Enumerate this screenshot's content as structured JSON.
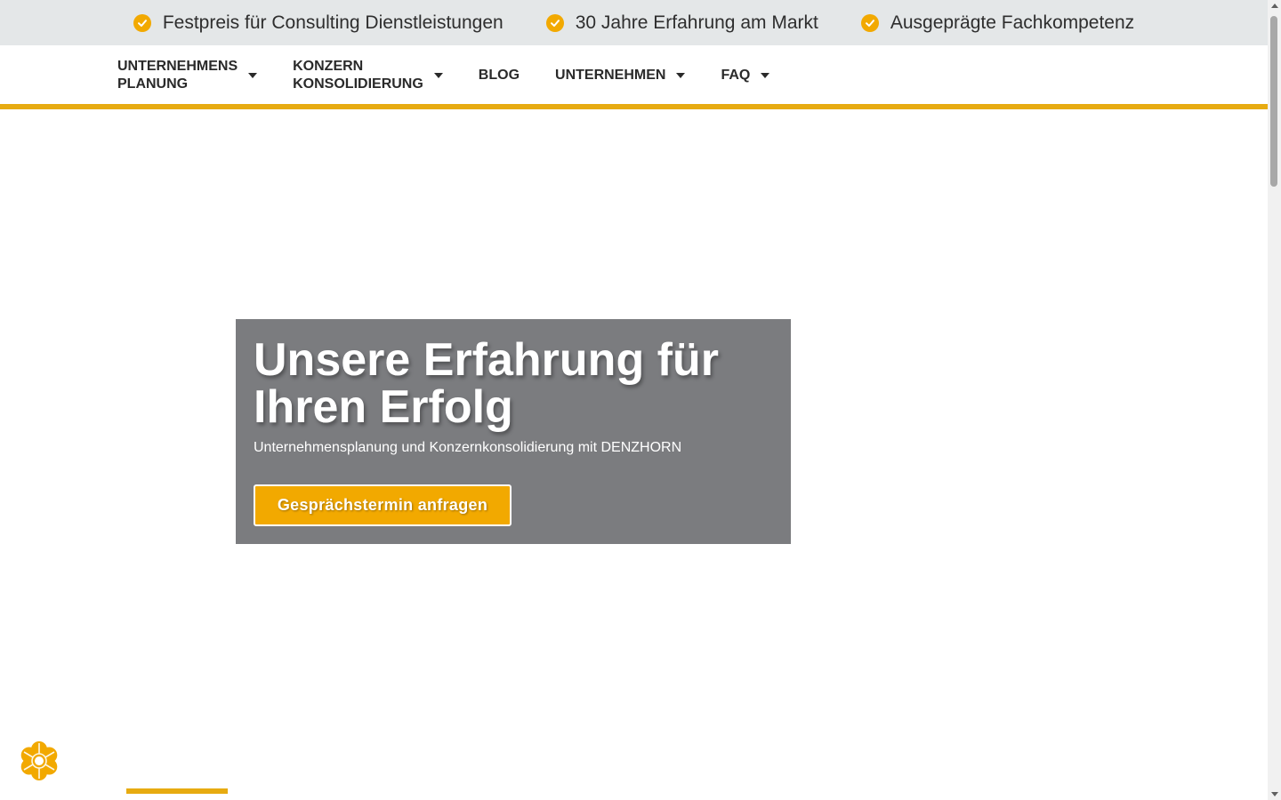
{
  "colors": {
    "accent": "#f2a900",
    "accent_bar": "#e7ab11",
    "topbar_bg": "#e4e7e8",
    "hero_bg": "#7b7c7f"
  },
  "topbar": {
    "items": [
      {
        "icon": "check-circle-icon",
        "label": "Festpreis für Consulting Dienstleistungen"
      },
      {
        "icon": "check-circle-icon",
        "label": "30 Jahre Erfahrung am Markt"
      },
      {
        "icon": "check-circle-icon",
        "label": "Ausgeprägte Fachkompetenz"
      }
    ]
  },
  "nav": {
    "items": [
      {
        "label": "UNTERNEHMENS\nPLANUNG",
        "dropdown": true
      },
      {
        "label": "KONZERN\nKONSOLIDIERUNG",
        "dropdown": true
      },
      {
        "label": "BLOG",
        "dropdown": false
      },
      {
        "label": "UNTERNEHMEN",
        "dropdown": true
      },
      {
        "label": "FAQ",
        "dropdown": true
      }
    ]
  },
  "hero": {
    "title": "Unsere Erfahrung für Ihren Erfolg",
    "subtitle": "Unternehmensplanung und Konzernkonsolidierung mit DENZHORN",
    "cta_label": "Gesprächstermin anfragen"
  },
  "cookie": {
    "icon": "cookie-settings-icon"
  }
}
